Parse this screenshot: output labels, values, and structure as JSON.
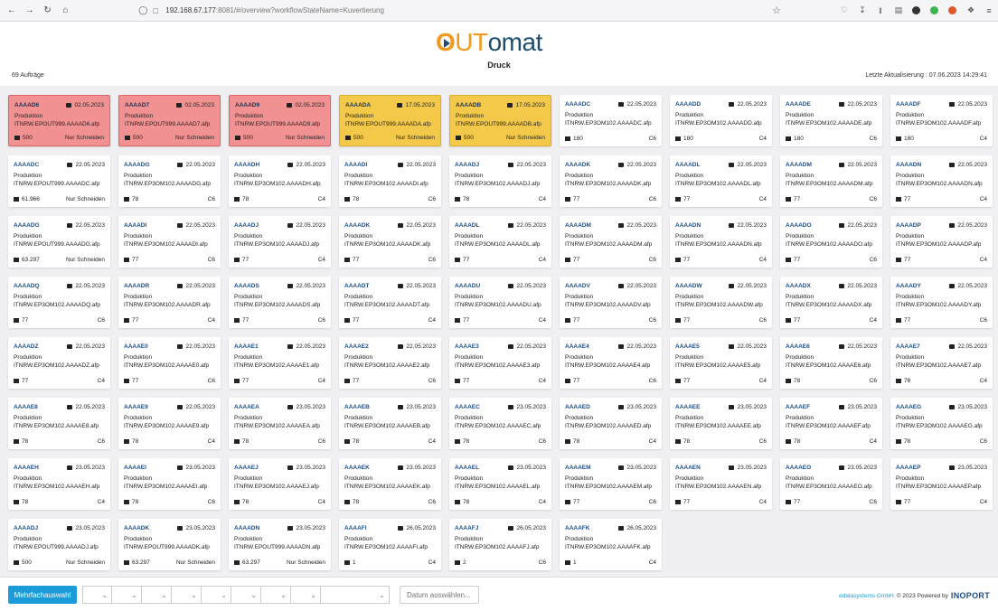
{
  "browser": {
    "url_host": "192.168.67.177",
    "url_rest": ":8081/#/overview?workflowStateName=Kuvertierung"
  },
  "header": {
    "logo_first": "O",
    "logo_ut": "UT",
    "logo_omat": "omat",
    "page_title": "Druck",
    "orders_count": "69 Aufträge",
    "last_update": "Letzte Aktualisierung : 07.06.2023 14:29:41"
  },
  "colors": {
    "red_card": "#f29191",
    "yellow_card": "#f4c94a",
    "accent": "#1b9bd7",
    "id_blue": "#1d4e8a"
  },
  "icons": {
    "calendar": "calendar-icon",
    "envelope": "envelope-icon"
  },
  "cards": [
    {
      "id": "AAAAD6",
      "date": "02.05.2023",
      "type": "Produktion",
      "file": "ITNRW.EPOUT999.AAAAD6.afp",
      "count": "500",
      "extra": "Nur Schneiden",
      "state": "red"
    },
    {
      "id": "AAAAD7",
      "date": "02.05.2023",
      "type": "Produktion",
      "file": "ITNRW.EPOUT999.AAAAD7.afp",
      "count": "500",
      "extra": "Nur Schneiden",
      "state": "red"
    },
    {
      "id": "AAAAD9",
      "date": "02.05.2023",
      "type": "Produktion",
      "file": "ITNRW.EPOUT999.AAAAD9.afp",
      "count": "500",
      "extra": "Nur Schneiden",
      "state": "red"
    },
    {
      "id": "AAAADA",
      "date": "17.05.2023",
      "type": "Produktion",
      "file": "ITNRW.EPOUT999.AAAADA.afp",
      "count": "500",
      "extra": "Nur Schneiden",
      "state": "yellow"
    },
    {
      "id": "AAAADB",
      "date": "17.05.2023",
      "type": "Produktion",
      "file": "ITNRW.EPOUT999.AAAADB.afp",
      "count": "500",
      "extra": "Nur Schneiden",
      "state": "yellow"
    },
    {
      "id": "AAAADC",
      "date": "22.05.2023",
      "type": "Produktion",
      "file": "ITNRW.EP3OM102.AAAADC.afp",
      "count": "180",
      "extra": "C6",
      "state": "normal"
    },
    {
      "id": "AAAADD",
      "date": "22.05.2023",
      "type": "Produktion",
      "file": "ITNRW.EP3OM102.AAAADD.afp",
      "count": "180",
      "extra": "C4",
      "state": "normal"
    },
    {
      "id": "AAAADE",
      "date": "22.05.2023",
      "type": "Produktion",
      "file": "ITNRW.EP3OM102.AAAADE.afp",
      "count": "180",
      "extra": "C6",
      "state": "normal"
    },
    {
      "id": "AAAADF",
      "date": "22.05.2023",
      "type": "Produktion",
      "file": "ITNRW.EP3OM102.AAAADF.afp",
      "count": "180",
      "extra": "C4",
      "state": "normal"
    },
    {
      "id": "AAAADC",
      "date": "22.05.2023",
      "type": "Produktion",
      "file": "ITNRW.EPOUT999.AAAADC.afp",
      "count": "61.966",
      "extra": "Nur Schneiden",
      "state": "normal"
    },
    {
      "id": "AAAADG",
      "date": "22.05.2023",
      "type": "Produktion",
      "file": "ITNRW.EP3OM102.AAAADG.afp",
      "count": "78",
      "extra": "C6",
      "state": "normal"
    },
    {
      "id": "AAAADH",
      "date": "22.05.2023",
      "type": "Produktion",
      "file": "ITNRW.EP3OM102.AAAADH.afp",
      "count": "78",
      "extra": "C4",
      "state": "normal"
    },
    {
      "id": "AAAADI",
      "date": "22.05.2023",
      "type": "Produktion",
      "file": "ITNRW.EP3OM102.AAAADI.afp",
      "count": "78",
      "extra": "C6",
      "state": "normal"
    },
    {
      "id": "AAAADJ",
      "date": "22.05.2023",
      "type": "Produktion",
      "file": "ITNRW.EP3OM102.AAAADJ.afp",
      "count": "78",
      "extra": "C4",
      "state": "normal"
    },
    {
      "id": "AAAADK",
      "date": "22.05.2023",
      "type": "Produktion",
      "file": "ITNRW.EP3OM102.AAAADK.afp",
      "count": "77",
      "extra": "C6",
      "state": "normal"
    },
    {
      "id": "AAAADL",
      "date": "22.05.2023",
      "type": "Produktion",
      "file": "ITNRW.EP3OM102.AAAADL.afp",
      "count": "77",
      "extra": "C4",
      "state": "normal"
    },
    {
      "id": "AAAADM",
      "date": "22.05.2023",
      "type": "Produktion",
      "file": "ITNRW.EP3OM102.AAAADM.afp",
      "count": "77",
      "extra": "C6",
      "state": "normal"
    },
    {
      "id": "AAAADN",
      "date": "22.05.2023",
      "type": "Produktion",
      "file": "ITNRW.EP3OM102.AAAADN.afp",
      "count": "77",
      "extra": "C4",
      "state": "normal"
    },
    {
      "id": "AAAADG",
      "date": "22.05.2023",
      "type": "Produktion",
      "file": "ITNRW.EPOUT999.AAAADG.afp",
      "count": "63.297",
      "extra": "Nur Schneiden",
      "state": "normal"
    },
    {
      "id": "AAAADI",
      "date": "22.05.2023",
      "type": "Produktion",
      "file": "ITNRW.EP3OM102.AAAADI.afp",
      "count": "77",
      "extra": "C6",
      "state": "normal"
    },
    {
      "id": "AAAADJ",
      "date": "22.05.2023",
      "type": "Produktion",
      "file": "ITNRW.EP3OM102.AAAADJ.afp",
      "count": "77",
      "extra": "C4",
      "state": "normal"
    },
    {
      "id": "AAAADK",
      "date": "22.05.2023",
      "type": "Produktion",
      "file": "ITNRW.EP3OM102.AAAADK.afp",
      "count": "77",
      "extra": "C6",
      "state": "normal"
    },
    {
      "id": "AAAADL",
      "date": "22.05.2023",
      "type": "Produktion",
      "file": "ITNRW.EP3OM102.AAAADL.afp",
      "count": "77",
      "extra": "C4",
      "state": "normal"
    },
    {
      "id": "AAAADM",
      "date": "22.05.2023",
      "type": "Produktion",
      "file": "ITNRW.EP3OM102.AAAADM.afp",
      "count": "77",
      "extra": "C6",
      "state": "normal"
    },
    {
      "id": "AAAADN",
      "date": "22.05.2023",
      "type": "Produktion",
      "file": "ITNRW.EP3OM102.AAAADN.afp",
      "count": "77",
      "extra": "C4",
      "state": "normal"
    },
    {
      "id": "AAAADO",
      "date": "22.05.2023",
      "type": "Produktion",
      "file": "ITNRW.EP3OM102.AAAADO.afp",
      "count": "77",
      "extra": "C6",
      "state": "normal"
    },
    {
      "id": "AAAADP",
      "date": "22.05.2023",
      "type": "Produktion",
      "file": "ITNRW.EP3OM102.AAAADP.afp",
      "count": "77",
      "extra": "C4",
      "state": "normal"
    },
    {
      "id": "AAAADQ",
      "date": "22.05.2023",
      "type": "Produktion",
      "file": "ITNRW.EP3OM102.AAAADQ.afp",
      "count": "77",
      "extra": "C6",
      "state": "normal"
    },
    {
      "id": "AAAADR",
      "date": "22.05.2023",
      "type": "Produktion",
      "file": "ITNRW.EP3OM102.AAAADR.afp",
      "count": "77",
      "extra": "C4",
      "state": "normal"
    },
    {
      "id": "AAAADS",
      "date": "22.05.2023",
      "type": "Produktion",
      "file": "ITNRW.EP3OM102.AAAADS.afp",
      "count": "77",
      "extra": "C6",
      "state": "normal"
    },
    {
      "id": "AAAADT",
      "date": "22.05.2023",
      "type": "Produktion",
      "file": "ITNRW.EP3OM102.AAAADT.afp",
      "count": "77",
      "extra": "C4",
      "state": "normal"
    },
    {
      "id": "AAAADU",
      "date": "22.05.2023",
      "type": "Produktion",
      "file": "ITNRW.EP3OM102.AAAADU.afp",
      "count": "77",
      "extra": "C4",
      "state": "normal"
    },
    {
      "id": "AAAADV",
      "date": "22.05.2023",
      "type": "Produktion",
      "file": "ITNRW.EP3OM102.AAAADV.afp",
      "count": "77",
      "extra": "C6",
      "state": "normal"
    },
    {
      "id": "AAAADW",
      "date": "22.05.2023",
      "type": "Produktion",
      "file": "ITNRW.EP3OM102.AAAADW.afp",
      "count": "77",
      "extra": "C6",
      "state": "normal"
    },
    {
      "id": "AAAADX",
      "date": "22.05.2023",
      "type": "Produktion",
      "file": "ITNRW.EP3OM102.AAAADX.afp",
      "count": "77",
      "extra": "C4",
      "state": "normal"
    },
    {
      "id": "AAAADY",
      "date": "22.05.2023",
      "type": "Produktion",
      "file": "ITNRW.EP3OM102.AAAADY.afp",
      "count": "77",
      "extra": "C6",
      "state": "normal"
    },
    {
      "id": "AAAADZ",
      "date": "22.05.2023",
      "type": "Produktion",
      "file": "ITNRW.EP3OM102.AAAADZ.afp",
      "count": "77",
      "extra": "C4",
      "state": "normal"
    },
    {
      "id": "AAAAE0",
      "date": "22.05.2023",
      "type": "Produktion",
      "file": "ITNRW.EP3OM102.AAAAE0.afp",
      "count": "77",
      "extra": "C6",
      "state": "normal"
    },
    {
      "id": "AAAAE1",
      "date": "22.05.2023",
      "type": "Produktion",
      "file": "ITNRW.EP3OM102.AAAAE1.afp",
      "count": "77",
      "extra": "C4",
      "state": "normal"
    },
    {
      "id": "AAAAE2",
      "date": "22.05.2023",
      "type": "Produktion",
      "file": "ITNRW.EP3OM102.AAAAE2.afp",
      "count": "77",
      "extra": "C6",
      "state": "normal"
    },
    {
      "id": "AAAAE3",
      "date": "22.05.2023",
      "type": "Produktion",
      "file": "ITNRW.EP3OM102.AAAAE3.afp",
      "count": "77",
      "extra": "C4",
      "state": "normal"
    },
    {
      "id": "AAAAE4",
      "date": "22.05.2023",
      "type": "Produktion",
      "file": "ITNRW.EP3OM102.AAAAE4.afp",
      "count": "77",
      "extra": "C6",
      "state": "normal"
    },
    {
      "id": "AAAAE5",
      "date": "22.05.2023",
      "type": "Produktion",
      "file": "ITNRW.EP3OM102.AAAAE5.afp",
      "count": "77",
      "extra": "C4",
      "state": "normal"
    },
    {
      "id": "AAAAE6",
      "date": "22.05.2023",
      "type": "Produktion",
      "file": "ITNRW.EP3OM102.AAAAE6.afp",
      "count": "78",
      "extra": "C6",
      "state": "normal"
    },
    {
      "id": "AAAAE7",
      "date": "22.05.2023",
      "type": "Produktion",
      "file": "ITNRW.EP3OM102.AAAAE7.afp",
      "count": "78",
      "extra": "C4",
      "state": "normal"
    },
    {
      "id": "AAAAE8",
      "date": "22.05.2023",
      "type": "Produktion",
      "file": "ITNRW.EP3OM102.AAAAE8.afp",
      "count": "78",
      "extra": "C6",
      "state": "normal"
    },
    {
      "id": "AAAAE9",
      "date": "22.05.2023",
      "type": "Produktion",
      "file": "ITNRW.EP3OM102.AAAAE9.afp",
      "count": "78",
      "extra": "C4",
      "state": "normal"
    },
    {
      "id": "AAAAEA",
      "date": "23.05.2023",
      "type": "Produktion",
      "file": "ITNRW.EP3OM102.AAAAEA.afp",
      "count": "78",
      "extra": "C6",
      "state": "normal"
    },
    {
      "id": "AAAAEB",
      "date": "23.05.2023",
      "type": "Produktion",
      "file": "ITNRW.EP3OM102.AAAAEB.afp",
      "count": "78",
      "extra": "C4",
      "state": "normal"
    },
    {
      "id": "AAAAEC",
      "date": "23.05.2023",
      "type": "Produktion",
      "file": "ITNRW.EP3OM102.AAAAEC.afp",
      "count": "78",
      "extra": "C6",
      "state": "normal"
    },
    {
      "id": "AAAAED",
      "date": "23.05.2023",
      "type": "Produktion",
      "file": "ITNRW.EP3OM102.AAAAED.afp",
      "count": "78",
      "extra": "C4",
      "state": "normal"
    },
    {
      "id": "AAAAEE",
      "date": "23.05.2023",
      "type": "Produktion",
      "file": "ITNRW.EP3OM102.AAAAEE.afp",
      "count": "78",
      "extra": "C6",
      "state": "normal"
    },
    {
      "id": "AAAAEF",
      "date": "23.05.2023",
      "type": "Produktion",
      "file": "ITNRW.EP3OM102.AAAAEF.afp",
      "count": "78",
      "extra": "C4",
      "state": "normal"
    },
    {
      "id": "AAAAEG",
      "date": "23.05.2023",
      "type": "Produktion",
      "file": "ITNRW.EP3OM102.AAAAEG.afp",
      "count": "78",
      "extra": "C6",
      "state": "normal"
    },
    {
      "id": "AAAAEH",
      "date": "23.05.2023",
      "type": "Produktion",
      "file": "ITNRW.EP3OM102.AAAAEH.afp",
      "count": "78",
      "extra": "C4",
      "state": "normal"
    },
    {
      "id": "AAAAEI",
      "date": "23.05.2023",
      "type": "Produktion",
      "file": "ITNRW.EP3OM102.AAAAEI.afp",
      "count": "78",
      "extra": "C6",
      "state": "normal"
    },
    {
      "id": "AAAAEJ",
      "date": "23.05.2023",
      "type": "Produktion",
      "file": "ITNRW.EP3OM102.AAAAEJ.afp",
      "count": "78",
      "extra": "C4",
      "state": "normal"
    },
    {
      "id": "AAAAEK",
      "date": "23.05.2023",
      "type": "Produktion",
      "file": "ITNRW.EP3OM102.AAAAEK.afp",
      "count": "78",
      "extra": "C6",
      "state": "normal"
    },
    {
      "id": "AAAAEL",
      "date": "23.05.2023",
      "type": "Produktion",
      "file": "ITNRW.EP3OM102.AAAAEL.afp",
      "count": "78",
      "extra": "C4",
      "state": "normal"
    },
    {
      "id": "AAAAEM",
      "date": "23.05.2023",
      "type": "Produktion",
      "file": "ITNRW.EP3OM102.AAAAEM.afp",
      "count": "77",
      "extra": "C6",
      "state": "normal"
    },
    {
      "id": "AAAAEN",
      "date": "23.05.2023",
      "type": "Produktion",
      "file": "ITNRW.EP3OM102.AAAAEN.afp",
      "count": "77",
      "extra": "C4",
      "state": "normal"
    },
    {
      "id": "AAAAEO",
      "date": "23.05.2023",
      "type": "Produktion",
      "file": "ITNRW.EP3OM102.AAAAEO.afp",
      "count": "77",
      "extra": "C6",
      "state": "normal"
    },
    {
      "id": "AAAAEP",
      "date": "23.05.2023",
      "type": "Produktion",
      "file": "ITNRW.EP3OM102.AAAAEP.afp",
      "count": "77",
      "extra": "C4",
      "state": "normal"
    },
    {
      "id": "AAAADJ",
      "date": "23.05.2023",
      "type": "Produktion",
      "file": "ITNRW.EPOUT999.AAAADJ.afp",
      "count": "500",
      "extra": "Nur Schneiden",
      "state": "normal"
    },
    {
      "id": "AAAADK",
      "date": "23.05.2023",
      "type": "Produktion",
      "file": "ITNRW.EPOUT999.AAAADK.afp",
      "count": "63.297",
      "extra": "Nur Schneiden",
      "state": "normal"
    },
    {
      "id": "AAAADN",
      "date": "23.05.2023",
      "type": "Produktion",
      "file": "ITNRW.EPOUT999.AAAADN.afp",
      "count": "63.297",
      "extra": "Nur Schneiden",
      "state": "normal"
    },
    {
      "id": "AAAAFI",
      "date": "26.05.2023",
      "type": "Produktion",
      "file": "ITNRW.EP3OM102.AAAAFI.afp",
      "count": "1",
      "extra": "C4",
      "state": "normal"
    },
    {
      "id": "AAAAFJ",
      "date": "26.05.2023",
      "type": "Produktion",
      "file": "ITNRW.EP3OM102.AAAAFJ.afp",
      "count": "2",
      "extra": "C6",
      "state": "normal"
    },
    {
      "id": "AAAAFK",
      "date": "26.05.2023",
      "type": "Produktion",
      "file": "ITNRW.EP3OM102.AAAAFK.afp",
      "count": "1",
      "extra": "C4",
      "state": "normal"
    }
  ],
  "footer": {
    "multi_select_label": "Mehrfachauswahl",
    "date_placeholder": "Datum auswählen...",
    "company": "edatasystems GmbH",
    "copyright": "© 2023 Powered by",
    "brand": "INOPORT"
  }
}
